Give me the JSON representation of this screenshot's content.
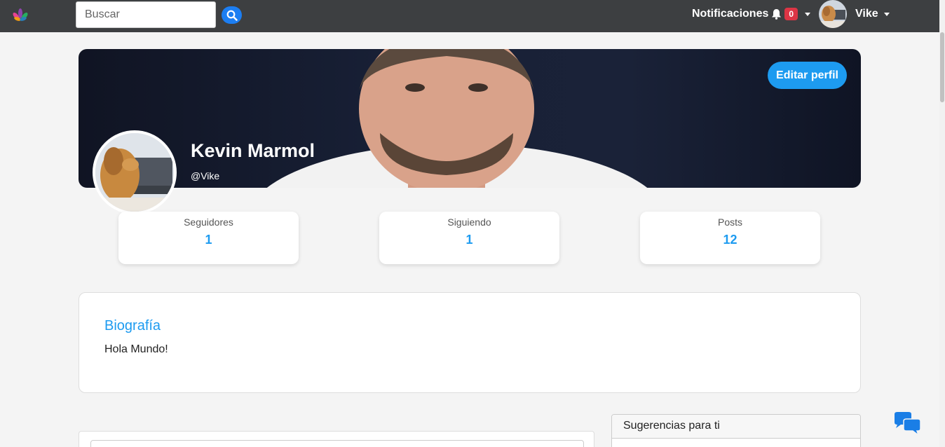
{
  "navbar": {
    "logo": "flower-logo-icon",
    "search": {
      "placeholder": "Buscar",
      "value": "",
      "icon": "search-icon"
    },
    "notifications": {
      "label": "Notificaciones",
      "count": "0",
      "icon": "bell-icon"
    },
    "user": {
      "name": "Vike",
      "avatar": "dog-avatar"
    }
  },
  "profile": {
    "edit_label": "Editar perfil",
    "name": "Kevin Marmol",
    "handle": "@Vike"
  },
  "stats": [
    {
      "label": "Seguidores",
      "value": "1"
    },
    {
      "label": "Siguiendo",
      "value": "1"
    },
    {
      "label": "Posts",
      "value": "12"
    }
  ],
  "bio": {
    "title": "Biografía",
    "text": "Hola Mundo!"
  },
  "sidebar": {
    "suggestions_title": "Sugerencias para ti"
  },
  "colors": {
    "accent": "#1d9bf0",
    "navbar": "#3d3f41",
    "badge": "#dc3545",
    "background": "#f4f4f4"
  },
  "chat": {
    "icon": "chat-bubbles-icon"
  }
}
